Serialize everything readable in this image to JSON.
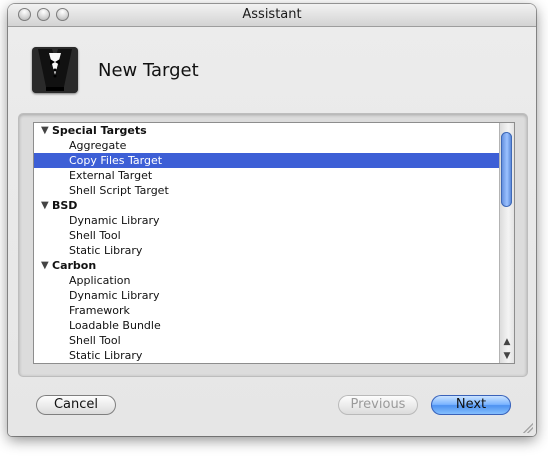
{
  "window": {
    "title": "Assistant",
    "header_title": "New Target"
  },
  "list": {
    "groups": [
      {
        "label": "Special Targets",
        "items": [
          "Aggregate",
          "Copy Files Target",
          "External Target",
          "Shell Script Target"
        ]
      },
      {
        "label": "BSD",
        "items": [
          "Dynamic Library",
          "Shell Tool",
          "Static Library"
        ]
      },
      {
        "label": "Carbon",
        "items": [
          "Application",
          "Dynamic Library",
          "Framework",
          "Loadable Bundle",
          "Shell Tool",
          "Static Library"
        ]
      }
    ],
    "selected_item": "Copy Files Target",
    "scroll_up_glyph": "▲",
    "scroll_down_glyph": "▼",
    "disclosure_glyph": "▼"
  },
  "buttons": {
    "cancel": "Cancel",
    "previous": "Previous",
    "next": "Next"
  },
  "colors": {
    "selection": "#3d5fd6",
    "primary_button": "#4d91f0"
  }
}
